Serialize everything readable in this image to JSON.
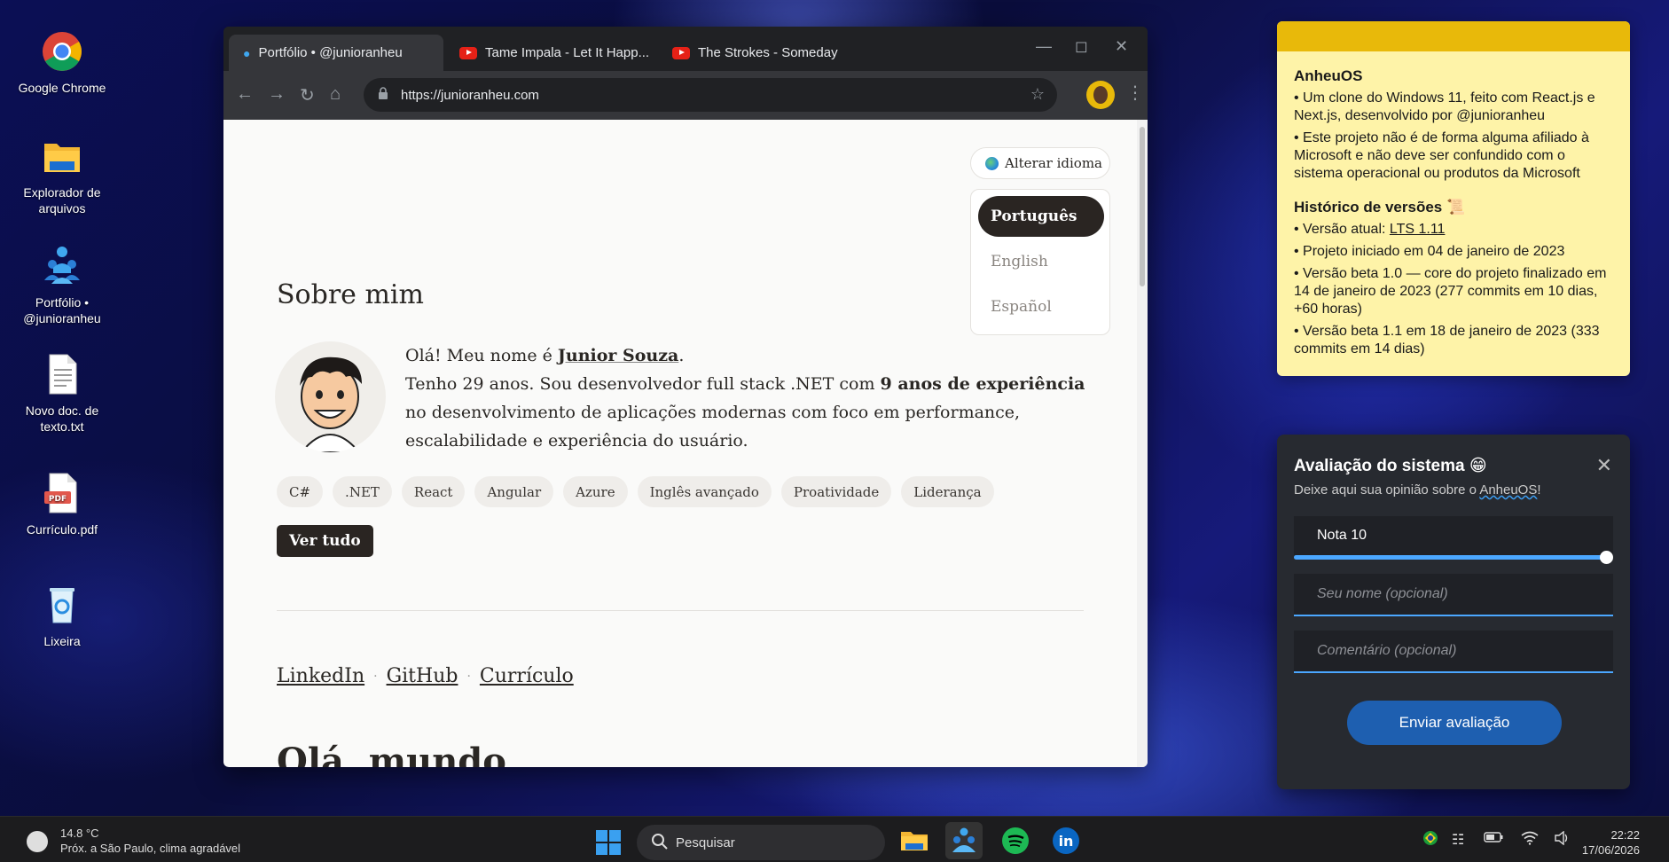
{
  "desktop": {
    "icons": [
      {
        "label": "Google Chrome"
      },
      {
        "label": "Explorador de arquivos"
      },
      {
        "label": "Portfólio • @junioranheu"
      },
      {
        "label": "Novo doc. de texto.txt"
      },
      {
        "label": "Currículo.pdf"
      },
      {
        "label": "Lixeira"
      }
    ]
  },
  "browser": {
    "tabs": [
      {
        "label": "Portfólio • @junioranheu",
        "active": true
      },
      {
        "label": "Tame Impala - Let It Happ..."
      },
      {
        "label": "The Strokes - Someday"
      }
    ],
    "url": "https://junioranheu.com"
  },
  "page": {
    "lang_button": "Alterar idioma",
    "languages": [
      "Português",
      "English",
      "Español"
    ],
    "about_title": "Sobre mim",
    "bio": {
      "greeting": "Olá! Meu nome é ",
      "name": "Junior Souza",
      "period": ".",
      "line2_a": "Tenho 29 anos. Sou desenvolvedor full stack .NET com ",
      "line2_b": "9 anos de experiência",
      "line2_c": " no desenvolvimento de aplicações modernas com foco em performance, escalabilidade e experiência do usuário."
    },
    "skills": [
      "C#",
      ".NET",
      "React",
      "Angular",
      "Azure",
      "Inglês avançado",
      "Proatividade",
      "Liderança"
    ],
    "see_all": "Ver tudo",
    "links": [
      "LinkedIn",
      "GitHub",
      "Currículo"
    ],
    "next_heading": "Olá, mundo"
  },
  "sticky": {
    "title": "AnheuOS",
    "p1": "• Um clone do Windows 11, feito com React.js e Next.js, desenvolvido por @junioranheu",
    "p2": "• Este projeto não é de forma alguma afiliado à Microsoft e não deve ser confundido com o sistema operacional ou produtos da Microsoft",
    "history_title": "Histórico de versões 📜",
    "version_label": "• Versão atual: ",
    "version_value": "LTS 1.11",
    "h1": "• Projeto iniciado em 04 de janeiro de 2023",
    "h2": "• Versão beta 1.0 — core do projeto finalizado em 14 de janeiro de 2023 (277 commits em 10 dias, +60 horas)",
    "h3": "• Versão beta 1.1 em 18 de janeiro de 2023 (333 commits em 14 dias)"
  },
  "rating": {
    "title": "Avaliação do sistema 😁",
    "subtitle_a": "Deixe aqui sua opinião sobre o ",
    "subtitle_b": "AnheuOS",
    "subtitle_c": "!",
    "score_label": "Nota 10",
    "score_fraction": 1.0,
    "name_placeholder": "Seu nome (opcional)",
    "comment_placeholder": "Comentário (opcional)",
    "submit": "Enviar avaliação"
  },
  "taskbar": {
    "temp": "14.8 °C",
    "weather": "Próx. a São Paulo, clima agradável",
    "search": "Pesquisar",
    "time": "22:22",
    "date": "17/06/2026"
  },
  "colors": {
    "sticky_header": "#e8b90a",
    "sticky_bg": "#fef3a8",
    "accent_blue": "#4ba7ff",
    "button_blue": "#1e5fb0"
  }
}
